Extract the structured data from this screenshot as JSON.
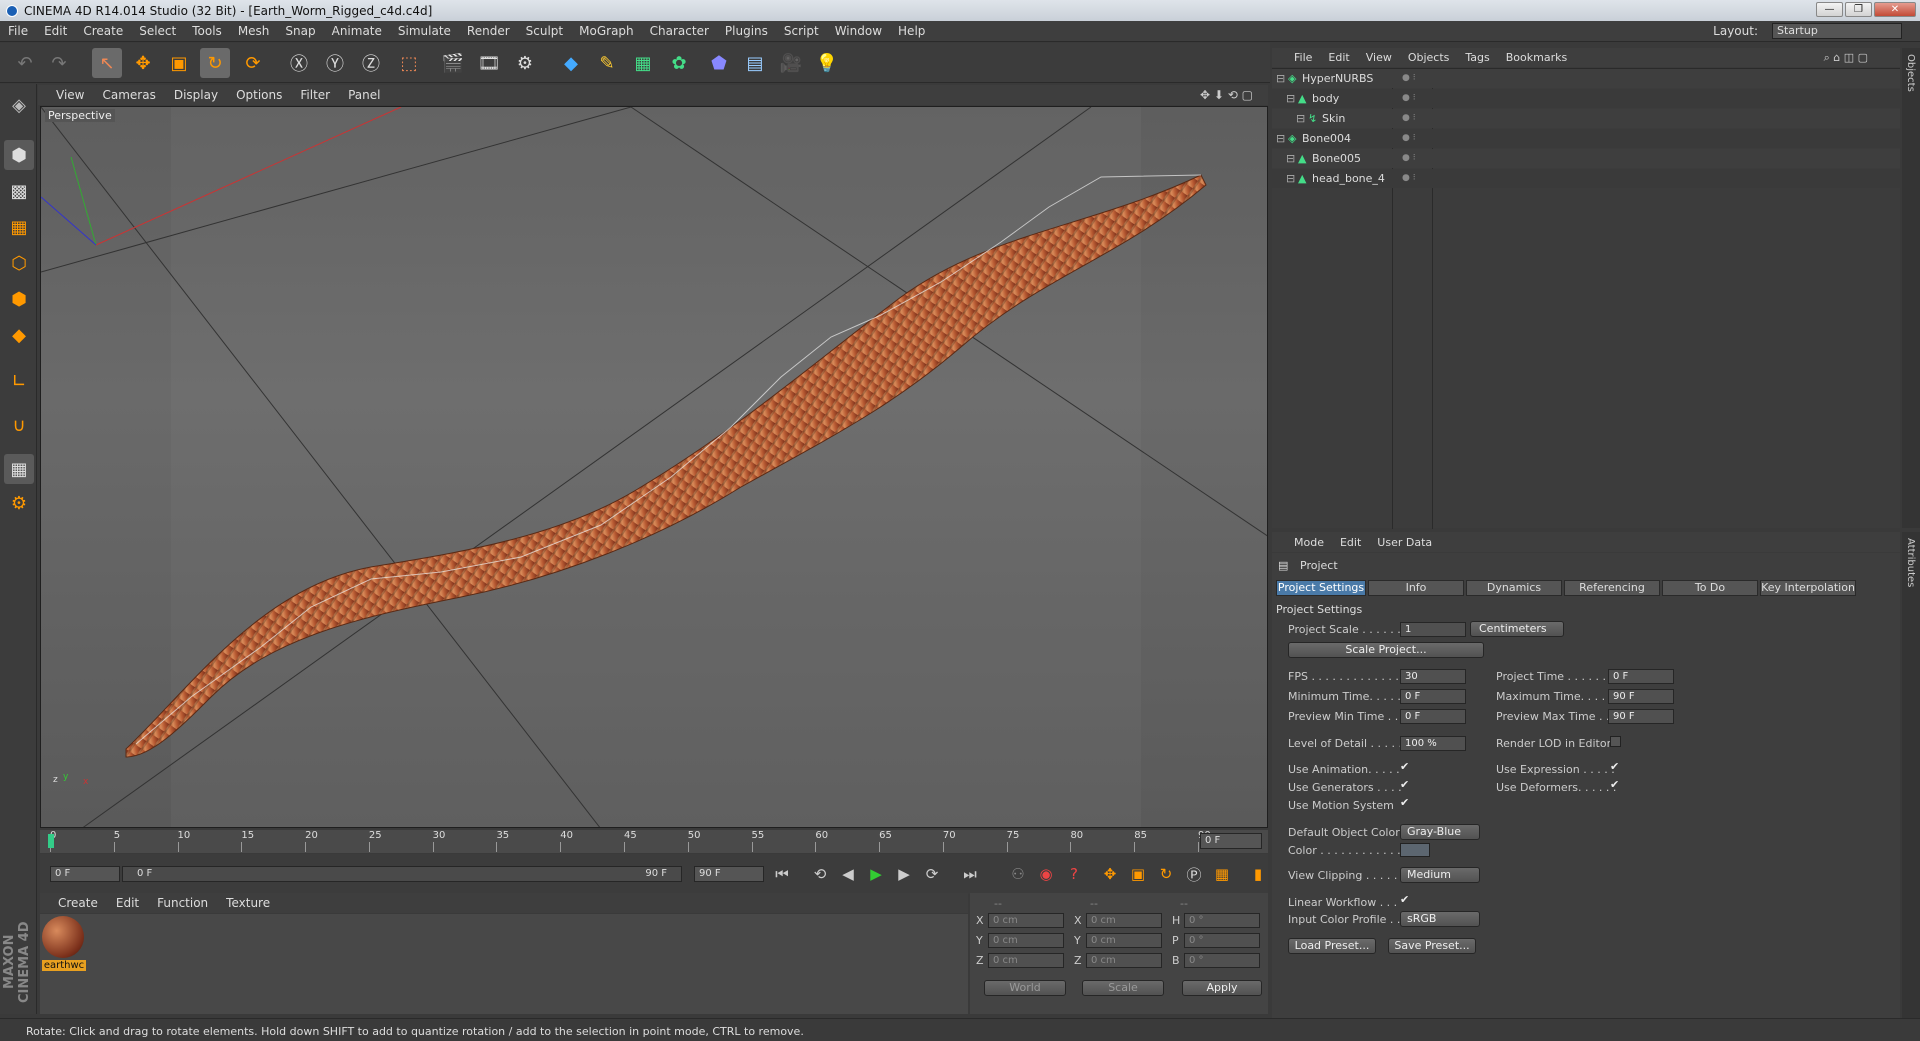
{
  "window": {
    "title": "CINEMA 4D R14.014 Studio (32 Bit) - [Earth_Worm_Rigged_c4d.c4d]"
  },
  "menu": [
    "File",
    "Edit",
    "Create",
    "Select",
    "Tools",
    "Mesh",
    "Snap",
    "Animate",
    "Simulate",
    "Render",
    "Sculpt",
    "MoGraph",
    "Character",
    "Plugins",
    "Script",
    "Window",
    "Help"
  ],
  "layout": {
    "label": "Layout:",
    "value": "Startup"
  },
  "viewport": {
    "menu": [
      "View",
      "Cameras",
      "Display",
      "Options",
      "Filter",
      "Panel"
    ],
    "label": "Perspective"
  },
  "timeline": {
    "ticks": [
      "0",
      "5",
      "10",
      "15",
      "20",
      "25",
      "30",
      "35",
      "40",
      "45",
      "50",
      "55",
      "60",
      "65",
      "70",
      "75",
      "80",
      "85",
      "90"
    ],
    "current": "0 F",
    "start": "0 F",
    "range_start": "0 F",
    "range_end": "90 F",
    "end": "90 F"
  },
  "materials": {
    "menu": [
      "Create",
      "Edit",
      "Function",
      "Texture"
    ],
    "item": "earthwc"
  },
  "coords": {
    "head": [
      "--",
      "--",
      "--"
    ],
    "rows": [
      [
        "X",
        "0 cm",
        "X",
        "0 cm",
        "H",
        "0 °"
      ],
      [
        "Y",
        "0 cm",
        "Y",
        "0 cm",
        "P",
        "0 °"
      ],
      [
        "Z",
        "0 cm",
        "Z",
        "0 cm",
        "B",
        "0 °"
      ]
    ],
    "world": "World",
    "scale": "Scale",
    "apply": "Apply"
  },
  "objects": {
    "menu": [
      "File",
      "Edit",
      "View",
      "Objects",
      "Tags",
      "Bookmarks"
    ],
    "items": [
      {
        "name": "HyperNURBS",
        "indent": 0
      },
      {
        "name": "body",
        "indent": 1
      },
      {
        "name": "Skin",
        "indent": 2
      },
      {
        "name": "Bone004",
        "indent": 0
      },
      {
        "name": "Bone005",
        "indent": 1
      },
      {
        "name": "head_bone_4",
        "indent": 1
      }
    ]
  },
  "attributes": {
    "menu": [
      "Mode",
      "Edit",
      "User Data"
    ],
    "object": "Project",
    "tabs": [
      "Project Settings",
      "Info",
      "Dynamics",
      "Referencing",
      "To Do",
      "Key Interpolation"
    ],
    "section": "Project Settings",
    "project_scale": {
      "label": "Project Scale . . . . . .",
      "value": "1",
      "unit": "Centimeters"
    },
    "scale_btn": "Scale Project...",
    "fps": {
      "label": "FPS . . . . . . . . . . . . . .",
      "value": "30"
    },
    "project_time": {
      "label": "Project Time . . . . . . . .",
      "value": "0 F"
    },
    "min_time": {
      "label": "Minimum Time. . . . . .",
      "value": "0 F"
    },
    "max_time": {
      "label": "Maximum Time. . . . . .",
      "value": "90 F"
    },
    "prev_min": {
      "label": "Preview Min Time . . .",
      "value": "0 F"
    },
    "prev_max": {
      "label": "Preview Max Time . . .",
      "value": "90 F"
    },
    "lod": {
      "label": "Level of Detail . . . . .",
      "value": "100 %"
    },
    "render_lod": "Render LOD in Editor",
    "use_anim": "Use Animation. . . . .",
    "use_expr": "Use Expression . . . . .",
    "use_gen": "Use Generators . . . .",
    "use_def": "Use Deformers. . . . . .",
    "use_motion": "Use Motion System",
    "def_color": {
      "label": "Default Object Color",
      "value": "Gray-Blue"
    },
    "color": "Color . . . . . . . . . . . .",
    "view_clip": {
      "label": "View Clipping . . . . .",
      "value": "Medium"
    },
    "linear": "Linear Workflow . . .",
    "input_profile": {
      "label": "Input Color Profile . .",
      "value": "sRGB"
    },
    "load": "Load Preset...",
    "save": "Save Preset..."
  },
  "status": "Rotate: Click and drag to rotate elements. Hold down SHIFT to add to quantize rotation / add to the selection in point mode, CTRL to remove.",
  "brand": "MAXON CINEMA 4D"
}
